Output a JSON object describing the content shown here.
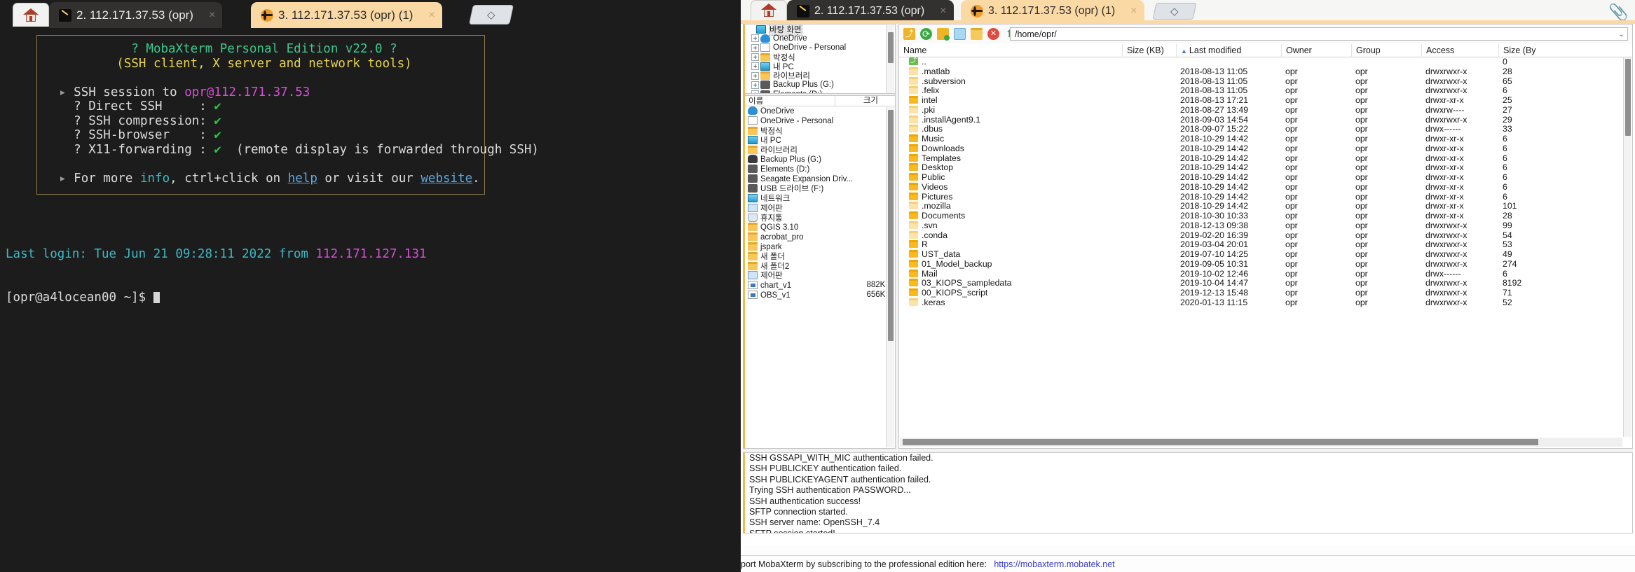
{
  "terminal_window": {
    "home_tab": {
      "icon": "home-icon",
      "label": ""
    },
    "tabs": [
      {
        "icon": "terminal-icon",
        "label": "2. 112.171.37.53 (opr)",
        "active": true,
        "close": "×"
      },
      {
        "icon": "globe-icon",
        "label": "3. 112.171.37.53 (opr) (1)",
        "active": false,
        "close": "×"
      }
    ],
    "new_tab_label": "◇",
    "banner": {
      "title": "? MobaXterm Personal Edition v22.0 ?",
      "subtitle": "(SSH client, X server and network tools)",
      "session_prefix": "SSH session to ",
      "session_target": "opr@112.171.37.53",
      "rows": [
        {
          "label": "? Direct SSH",
          "sep": ":",
          "check": "✔",
          "note": ""
        },
        {
          "label": "? SSH compression",
          "sep": ":",
          "check": "✔",
          "note": ""
        },
        {
          "label": "? SSH-browser",
          "sep": ":",
          "check": "✔",
          "note": ""
        },
        {
          "label": "? X11-forwarding",
          "sep": ":",
          "check": "✔",
          "note": "(remote display is forwarded through SSH)"
        }
      ],
      "footer_pre": "For more ",
      "footer_info": "info",
      "footer_mid": ", ctrl+click on ",
      "footer_help": "help",
      "footer_mid2": " or visit our ",
      "footer_website": "website",
      "footer_end": "."
    },
    "last_login_prefix": "Last login: Tue Jun 21 09:28:11 2022 from ",
    "last_login_ip": "112.171.127.131",
    "prompt": "[opr@a4locean00 ~]$ "
  },
  "sftp_window": {
    "tabs": [
      {
        "icon": "terminal-icon",
        "label": "2. 112.171.37.53 (opr)",
        "active": false,
        "close": "×"
      },
      {
        "icon": "globe-icon",
        "label": "3. 112.171.37.53 (opr) (1)",
        "active": true,
        "close": "×"
      }
    ],
    "new_tab_label": "◇",
    "attach_icon": "paperclip-icon",
    "local_tree": [
      {
        "label": "바탕 화면",
        "icon": "desktop-icon",
        "expander": false,
        "selected": true,
        "indent": 0
      },
      {
        "label": "OneDrive",
        "icon": "cloud-icon",
        "expander": true,
        "selected": false,
        "indent": 1
      },
      {
        "label": "OneDrive - Personal",
        "icon": "document-icon",
        "expander": true,
        "selected": false,
        "indent": 1
      },
      {
        "label": "박정식",
        "icon": "folder-icon",
        "expander": true,
        "selected": false,
        "indent": 1
      },
      {
        "label": "내 PC",
        "icon": "computer-icon",
        "expander": true,
        "selected": false,
        "indent": 1
      },
      {
        "label": "라이브러리",
        "icon": "folder-icon",
        "expander": true,
        "selected": false,
        "indent": 1
      },
      {
        "label": "Backup Plus (G:)",
        "icon": "harddisk-icon",
        "expander": true,
        "selected": false,
        "indent": 1
      },
      {
        "label": "Elements (D:)",
        "icon": "harddisk-icon",
        "expander": true,
        "selected": false,
        "indent": 1
      }
    ],
    "local_list_header": {
      "name": "이름",
      "size": "크기"
    },
    "local_list": [
      {
        "name": "OneDrive",
        "icon": "cloud-icon",
        "size": ""
      },
      {
        "name": "OneDrive - Personal",
        "icon": "document-icon",
        "size": ""
      },
      {
        "name": "박정식",
        "icon": "folder-icon",
        "size": ""
      },
      {
        "name": "내 PC",
        "icon": "computer-icon",
        "size": ""
      },
      {
        "name": "라이브러리",
        "icon": "folder-icon",
        "size": ""
      },
      {
        "name": "Backup Plus (G:)",
        "icon": "harddisk-black-icon",
        "size": ""
      },
      {
        "name": "Elements (D:)",
        "icon": "harddisk-icon",
        "size": ""
      },
      {
        "name": "Seagate Expansion Driv...",
        "icon": "harddisk-icon",
        "size": ""
      },
      {
        "name": "USB 드라이브 (F:)",
        "icon": "harddisk-icon",
        "size": ""
      },
      {
        "name": "네트워크",
        "icon": "network-icon",
        "size": ""
      },
      {
        "name": "제어판",
        "icon": "controlpanel-icon",
        "size": ""
      },
      {
        "name": "휴지통",
        "icon": "trash-icon",
        "size": ""
      },
      {
        "name": "QGIS 3.10",
        "icon": "folder-icon",
        "size": ""
      },
      {
        "name": "acrobat_pro",
        "icon": "folder-icon",
        "size": ""
      },
      {
        "name": "jspark",
        "icon": "folder-icon",
        "size": ""
      },
      {
        "name": "새 폴더",
        "icon": "folder-icon",
        "size": ""
      },
      {
        "name": "새 폴더2",
        "icon": "folder-icon",
        "size": ""
      },
      {
        "name": "제어판",
        "icon": "controlpanel-icon",
        "size": ""
      },
      {
        "name": "chart_v1",
        "icon": "file-icon",
        "size": "882KB"
      },
      {
        "name": "OBS_v1",
        "icon": "file-icon",
        "size": "656KB"
      }
    ],
    "toolbar": {
      "icons": [
        "parent-folder-icon",
        "refresh-icon",
        "new-folder-icon",
        "new-file-icon",
        "open-folder-icon",
        "delete-icon",
        "upload-icon",
        "download-icon"
      ],
      "path": "/home/opr/",
      "dropdown_caret": "⌄"
    },
    "columns": [
      {
        "key": "name",
        "label": "Name"
      },
      {
        "key": "size_kb",
        "label": "Size (KB)"
      },
      {
        "key": "modified",
        "label": "Last modified",
        "sorted": true
      },
      {
        "key": "owner",
        "label": "Owner"
      },
      {
        "key": "group",
        "label": "Group"
      },
      {
        "key": "access",
        "label": "Access"
      },
      {
        "key": "size_bytes",
        "label": "Size (By"
      }
    ],
    "remote_files": [
      {
        "name": "..",
        "icon": "parent-folder-icon",
        "size_kb": "",
        "modified": "",
        "owner": "",
        "group": "",
        "access": "",
        "size_bytes": "0"
      },
      {
        "name": ".matlab",
        "icon": "folder-light-icon",
        "size_kb": "",
        "modified": "2018-08-13 11:05",
        "owner": "opr",
        "group": "opr",
        "access": "drwxrwxr-x",
        "size_bytes": "28"
      },
      {
        "name": ".subversion",
        "icon": "folder-light-icon",
        "size_kb": "",
        "modified": "2018-08-13 11:05",
        "owner": "opr",
        "group": "opr",
        "access": "drwxrwxr-x",
        "size_bytes": "65"
      },
      {
        "name": ".felix",
        "icon": "folder-light-icon",
        "size_kb": "",
        "modified": "2018-08-13 11:05",
        "owner": "opr",
        "group": "opr",
        "access": "drwxrwxr-x",
        "size_bytes": "6"
      },
      {
        "name": "intel",
        "icon": "folder-icon",
        "size_kb": "",
        "modified": "2018-08-13 17:21",
        "owner": "opr",
        "group": "opr",
        "access": "drwxr-xr-x",
        "size_bytes": "25"
      },
      {
        "name": ".pki",
        "icon": "folder-light-icon",
        "size_kb": "",
        "modified": "2018-08-27 13:49",
        "owner": "opr",
        "group": "opr",
        "access": "drwxrw----",
        "size_bytes": "27"
      },
      {
        "name": ".installAgent9.1",
        "icon": "folder-light-icon",
        "size_kb": "",
        "modified": "2018-09-03 14:54",
        "owner": "opr",
        "group": "opr",
        "access": "drwxrwxr-x",
        "size_bytes": "29"
      },
      {
        "name": ".dbus",
        "icon": "folder-light-icon",
        "size_kb": "",
        "modified": "2018-09-07 15:22",
        "owner": "opr",
        "group": "opr",
        "access": "drwx------",
        "size_bytes": "33"
      },
      {
        "name": "Music",
        "icon": "folder-icon",
        "size_kb": "",
        "modified": "2018-10-29 14:42",
        "owner": "opr",
        "group": "opr",
        "access": "drwxr-xr-x",
        "size_bytes": "6"
      },
      {
        "name": "Downloads",
        "icon": "folder-icon",
        "size_kb": "",
        "modified": "2018-10-29 14:42",
        "owner": "opr",
        "group": "opr",
        "access": "drwxr-xr-x",
        "size_bytes": "6"
      },
      {
        "name": "Templates",
        "icon": "folder-icon",
        "size_kb": "",
        "modified": "2018-10-29 14:42",
        "owner": "opr",
        "group": "opr",
        "access": "drwxr-xr-x",
        "size_bytes": "6"
      },
      {
        "name": "Desktop",
        "icon": "folder-icon",
        "size_kb": "",
        "modified": "2018-10-29 14:42",
        "owner": "opr",
        "group": "opr",
        "access": "drwxr-xr-x",
        "size_bytes": "6"
      },
      {
        "name": "Public",
        "icon": "folder-icon",
        "size_kb": "",
        "modified": "2018-10-29 14:42",
        "owner": "opr",
        "group": "opr",
        "access": "drwxr-xr-x",
        "size_bytes": "6"
      },
      {
        "name": "Videos",
        "icon": "folder-icon",
        "size_kb": "",
        "modified": "2018-10-29 14:42",
        "owner": "opr",
        "group": "opr",
        "access": "drwxr-xr-x",
        "size_bytes": "6"
      },
      {
        "name": "Pictures",
        "icon": "folder-icon",
        "size_kb": "",
        "modified": "2018-10-29 14:42",
        "owner": "opr",
        "group": "opr",
        "access": "drwxr-xr-x",
        "size_bytes": "6"
      },
      {
        "name": ".mozilla",
        "icon": "folder-light-icon",
        "size_kb": "",
        "modified": "2018-10-29 14:42",
        "owner": "opr",
        "group": "opr",
        "access": "drwxr-xr-x",
        "size_bytes": "101"
      },
      {
        "name": "Documents",
        "icon": "folder-icon",
        "size_kb": "",
        "modified": "2018-10-30 10:33",
        "owner": "opr",
        "group": "opr",
        "access": "drwxr-xr-x",
        "size_bytes": "28"
      },
      {
        "name": ".svn",
        "icon": "folder-light-icon",
        "size_kb": "",
        "modified": "2018-12-13 09:38",
        "owner": "opr",
        "group": "opr",
        "access": "drwxrwxr-x",
        "size_bytes": "99"
      },
      {
        "name": ".conda",
        "icon": "folder-light-icon",
        "size_kb": "",
        "modified": "2019-02-20 16:39",
        "owner": "opr",
        "group": "opr",
        "access": "drwxrwxr-x",
        "size_bytes": "54"
      },
      {
        "name": "R",
        "icon": "folder-icon",
        "size_kb": "",
        "modified": "2019-03-04 20:01",
        "owner": "opr",
        "group": "opr",
        "access": "drwxrwxr-x",
        "size_bytes": "53"
      },
      {
        "name": "UST_data",
        "icon": "folder-icon",
        "size_kb": "",
        "modified": "2019-07-10 14:25",
        "owner": "opr",
        "group": "opr",
        "access": "drwxrwxr-x",
        "size_bytes": "49"
      },
      {
        "name": "01_Model_backup",
        "icon": "folder-icon",
        "size_kb": "",
        "modified": "2019-09-05 10:31",
        "owner": "opr",
        "group": "opr",
        "access": "drwxrwxr-x",
        "size_bytes": "274"
      },
      {
        "name": "Mail",
        "icon": "folder-icon",
        "size_kb": "",
        "modified": "2019-10-02 12:46",
        "owner": "opr",
        "group": "opr",
        "access": "drwx------",
        "size_bytes": "6"
      },
      {
        "name": "03_KIOPS_sampledata",
        "icon": "folder-icon",
        "size_kb": "",
        "modified": "2019-10-04 14:47",
        "owner": "opr",
        "group": "opr",
        "access": "drwxrwxr-x",
        "size_bytes": "8192"
      },
      {
        "name": "00_KIOPS_script",
        "icon": "folder-icon",
        "size_kb": "",
        "modified": "2019-12-13 15:48",
        "owner": "opr",
        "group": "opr",
        "access": "drwxrwxr-x",
        "size_bytes": "71"
      },
      {
        "name": ".keras",
        "icon": "folder-light-icon",
        "size_kb": "",
        "modified": "2020-01-13 11:15",
        "owner": "opr",
        "group": "opr",
        "access": "drwxrwxr-x",
        "size_bytes": "52"
      }
    ],
    "log_lines": [
      "SSH GSSAPI_WITH_MIC authentication failed.",
      "SSH PUBLICKEY authentication failed.",
      "SSH PUBLICKEYAGENT authentication failed.",
      "Trying SSH authentication PASSWORD...",
      "SSH authentication success!",
      "SFTP connection started.",
      "SSH server name: OpenSSH_7.4",
      "SFTP session started!"
    ],
    "status_text": "port MobaXterm by subscribing to the professional edition here:",
    "status_link": "https://mobaxterm.mobatek.net"
  }
}
